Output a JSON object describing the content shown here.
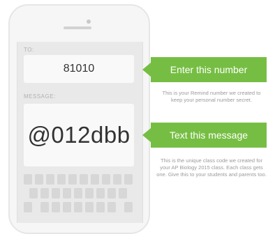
{
  "phone": {
    "to_label": "TO:",
    "to_value": "81010",
    "message_label": "MESSAGE:",
    "message_value": "@012dbb"
  },
  "callouts": {
    "number_title": "Enter this number",
    "number_desc": "This is your Remind number we created to keep your personal number secret.",
    "message_title": "Text this message",
    "message_desc": "This is the unique class code we created for your AP Biology 2015 class. Each class gets one. Give this to your students and parents too."
  },
  "colors": {
    "accent": "#76be43"
  }
}
